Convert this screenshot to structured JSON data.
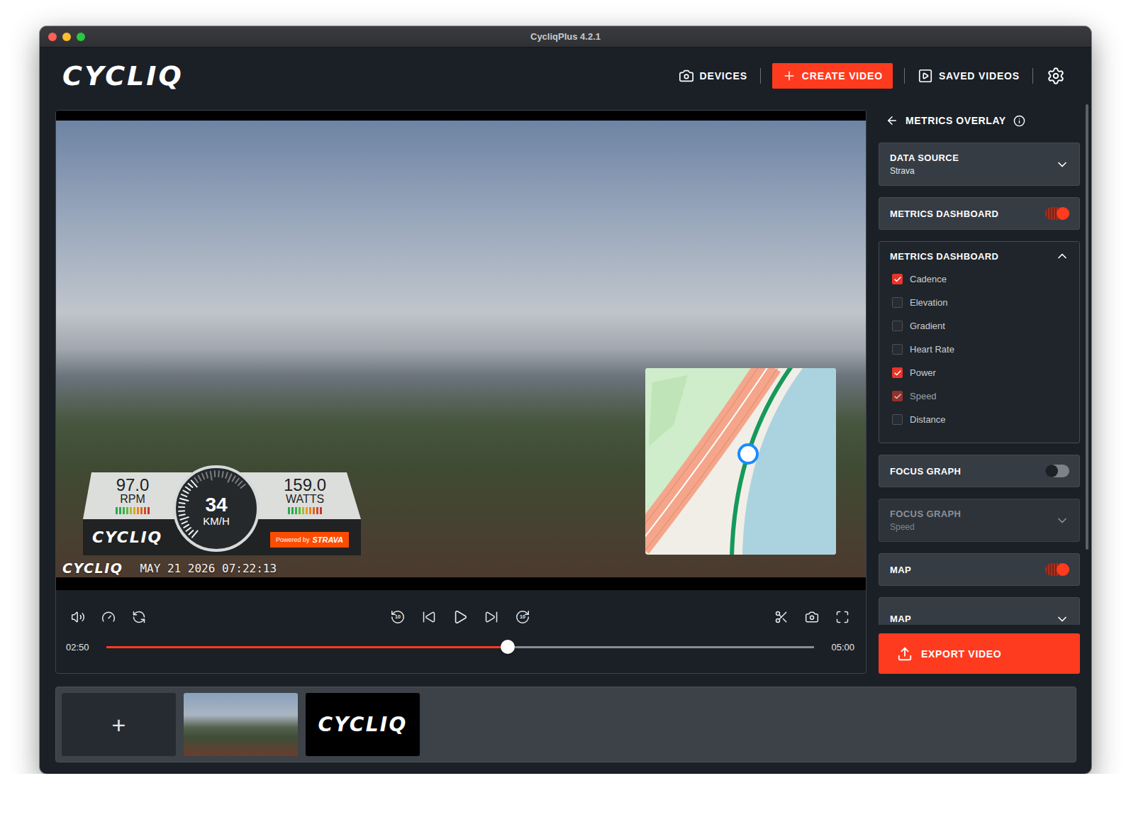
{
  "window": {
    "title": "CycliqPlus 4.2.1"
  },
  "header": {
    "logo": "CYCLIQ",
    "nav": [
      {
        "label": "DEVICES",
        "selected": false
      },
      {
        "label": "CREATE VIDEO",
        "selected": true
      },
      {
        "label": "SAVED VIDEOS",
        "selected": false
      }
    ]
  },
  "player": {
    "dashboard": {
      "metrics": [
        {
          "value": "97.0",
          "unit": "RPM",
          "level": 1
        },
        {
          "value": "159.0",
          "unit": "WATTS",
          "level": 1
        }
      ],
      "speed": {
        "value": "34",
        "unit": "KM/H",
        "level": 0.55
      },
      "logo": "CYCLIQ",
      "badge": {
        "prefix": "Powered by",
        "brand": "STRAVA"
      }
    },
    "stamp": {
      "logo": "CYCLIQ",
      "text": "MAY 21 2026 07:22:13"
    },
    "playing": false,
    "skip_seconds": "10",
    "time": "02:50",
    "duration": "05:00",
    "level": 0.567
  },
  "panel": {
    "back_title": "METRICS OVERLAY",
    "sections": [
      {
        "kind": "select",
        "title": "DATA SOURCE",
        "value": "Strava",
        "disabled": false,
        "expanded": false
      },
      {
        "kind": "toggle",
        "title": "METRICS DASHBOARD",
        "on": true
      },
      {
        "kind": "checklist",
        "title": "METRICS DASHBOARD",
        "expanded": true,
        "items": [
          {
            "label": "Cadence",
            "checked": true,
            "disabled": false
          },
          {
            "label": "Elevation",
            "checked": false,
            "disabled": false
          },
          {
            "label": "Gradient",
            "checked": false,
            "disabled": false
          },
          {
            "label": "Heart Rate",
            "checked": false,
            "disabled": false
          },
          {
            "label": "Power",
            "checked": true,
            "disabled": false
          },
          {
            "label": "Speed",
            "checked": true,
            "disabled": true
          },
          {
            "label": "Distance",
            "checked": false,
            "disabled": false
          }
        ]
      },
      {
        "kind": "toggle",
        "title": "FOCUS GRAPH",
        "on": false
      },
      {
        "kind": "select",
        "title": "FOCUS GRAPH",
        "value": "Speed",
        "disabled": true,
        "expanded": false
      },
      {
        "kind": "toggle",
        "title": "MAP",
        "on": true
      },
      {
        "kind": "select",
        "title": "MAP",
        "disabled": false,
        "expanded": false
      }
    ]
  },
  "export": {
    "label": "EXPORT VIDEO"
  },
  "timeline": [
    {
      "kind": "add",
      "label": "+"
    },
    {
      "kind": "video"
    },
    {
      "kind": "logo",
      "label": "CYCLIQ"
    }
  ]
}
